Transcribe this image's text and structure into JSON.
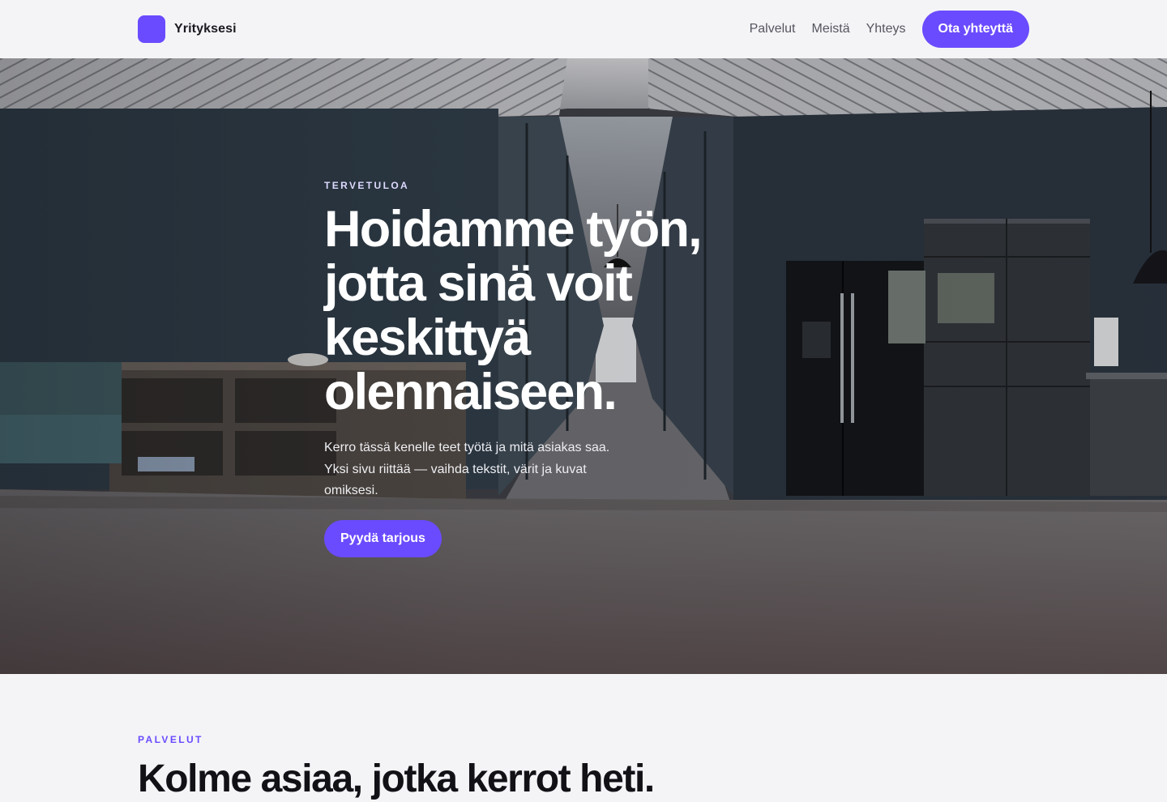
{
  "header": {
    "brand_name": "Yrityksesi",
    "nav": [
      {
        "label": "Palvelut"
      },
      {
        "label": "Meistä"
      },
      {
        "label": "Yhteys"
      }
    ],
    "cta_label": "Ota yhteyttä"
  },
  "hero": {
    "eyebrow": "TERVETULOA",
    "title": "Hoidamme työn,\njotta sinä voit\nkeskittyä\nolennaiseen.",
    "description": "Kerro tässä kenelle teet työtä ja mitä asiakas saa. Yksi sivu riittää — vaihda tekstit, värit ja kuvat omiksesi.",
    "cta_label": "Pyydä tarjous"
  },
  "services": {
    "eyebrow": "PALVELUT",
    "title": "Kolme asiaa, jotka kerrot heti."
  },
  "colors": {
    "accent": "#6b4bff",
    "background": "#f4f4f7"
  }
}
